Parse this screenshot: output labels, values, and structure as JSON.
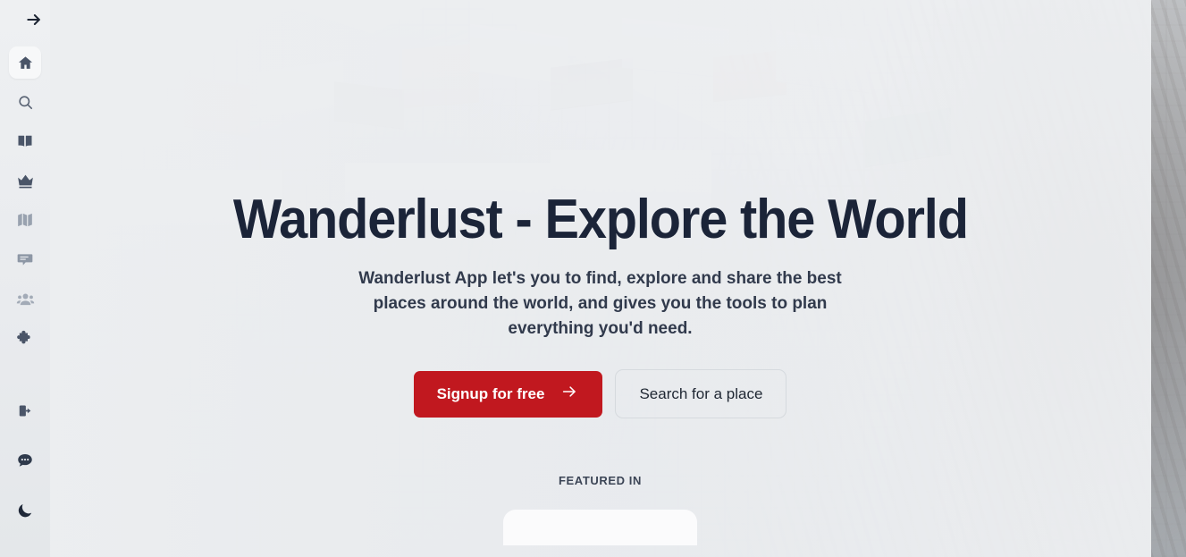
{
  "app": {
    "name": "Wanderlust",
    "background_image_description": "snow-covered alpine village beside a lake (washed out)"
  },
  "colors": {
    "accent_red": "#c1181f",
    "heading": "#1b2438",
    "body_text": "#313a4c",
    "sidebar_bg": "#eef0f2",
    "page_bg": "#eceef0",
    "icon": "#4a5568",
    "icon_dim": "#8b96a5"
  },
  "sidebar": {
    "toggle": {
      "name": "expand-sidebar",
      "icon": "arrow-right-icon",
      "label": ""
    },
    "items": [
      {
        "icon": "home-icon",
        "name": "home",
        "label": "Home",
        "active": true,
        "dim": 0
      },
      {
        "icon": "search-icon",
        "name": "search",
        "label": "Search",
        "active": false,
        "dim": 0
      },
      {
        "icon": "book-icon",
        "name": "guides",
        "label": "Guides",
        "active": false,
        "dim": 0
      },
      {
        "icon": "crown-icon",
        "name": "premium",
        "label": "Premium",
        "active": false,
        "dim": 0
      },
      {
        "icon": "map-icon",
        "name": "map",
        "label": "Map",
        "active": false,
        "dim": 1
      },
      {
        "icon": "comment-icon",
        "name": "messages",
        "label": "Messages",
        "active": false,
        "dim": 1
      },
      {
        "icon": "users-icon",
        "name": "community",
        "label": "Community",
        "active": false,
        "dim": 2
      },
      {
        "icon": "puzzle-icon",
        "name": "integrations",
        "label": "Integrations",
        "active": false,
        "dim": 0
      }
    ],
    "bottom_items": [
      {
        "icon": "logout-icon",
        "name": "logout",
        "label": "Log out"
      },
      {
        "icon": "chat-dots-icon",
        "name": "support",
        "label": "Support chat"
      },
      {
        "icon": "moon-icon",
        "name": "dark-mode",
        "label": "Dark mode"
      }
    ]
  },
  "hero": {
    "title": "Wanderlust - Explore the World",
    "subtitle": "Wanderlust App let's you to find, explore and share the best places around the world, and gives you the tools to plan everything you'd need.",
    "primary_cta": {
      "label": "Signup for free",
      "icon": "arrow-right-icon"
    },
    "secondary_cta": {
      "label": "Search for a place"
    },
    "featured_label": "FEATURED IN"
  }
}
